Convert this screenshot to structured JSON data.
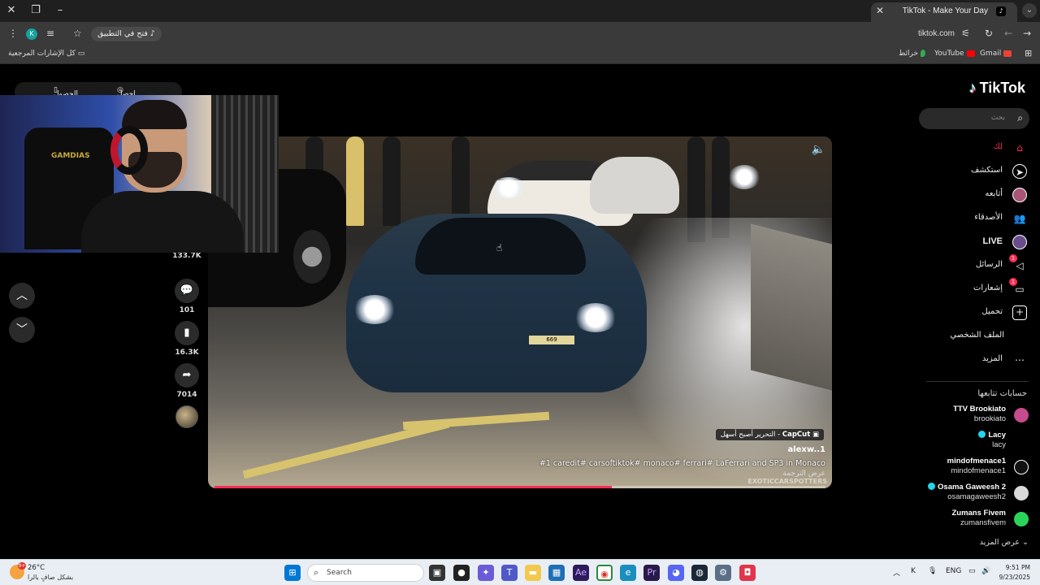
{
  "browser": {
    "tab_title": "TikTok - Make Your Day",
    "url": "tiktok.com",
    "open_in_app": "فتح في التطبيق",
    "profile_initial": "K",
    "bookmarks": {
      "all": "كل الإشارات المرجعية",
      "gmail": "Gmail",
      "youtube": "YouTube",
      "maps": "خرائط"
    }
  },
  "page": {
    "get_coins": "احصل على عملات",
    "get_app": "الحصول على الت..."
  },
  "webcam": {
    "chair_logo": "GAMDIAS"
  },
  "rail": {
    "likes": "133.7K",
    "comments": "101",
    "saves": "16.3K",
    "shares": "7014"
  },
  "video": {
    "capcut_label": "CapCut",
    "capcut_tagline": "التحرير أصبح أسهل",
    "author": "alexw..1",
    "description": "#1 caredit# carsoftiktok# monaco# ferrari# LaFerrari and SP3 in Monaco",
    "see_translation": "عرض الترجمة",
    "watermark": "EXOTICCARSPOTTERS",
    "plate": "669",
    "progress": 0.65
  },
  "sidebar": {
    "logo": "TikTok",
    "search_placeholder": "بحث",
    "nav": [
      {
        "label": "لك"
      },
      {
        "label": "استكشف"
      },
      {
        "label": "أتابعه"
      },
      {
        "label": "الأصدقاء"
      },
      {
        "label": "LIVE"
      },
      {
        "label": "الرسائل",
        "badge": "1"
      },
      {
        "label": "إشعارات",
        "badge": "1"
      },
      {
        "label": "تحميل"
      },
      {
        "label": "الملف الشخصي"
      },
      {
        "label": "المزيد"
      }
    ],
    "following_title": "حسابات تتابعها",
    "accounts": [
      {
        "name": "TTV Brookiato",
        "handle": "brookiato",
        "verified": false,
        "color": "#c64b8c"
      },
      {
        "name": "Lacy",
        "handle": "lacy",
        "verified": true,
        "color": "#000000"
      },
      {
        "name": "mindofmenace1",
        "handle": "mindofmenace1",
        "verified": false,
        "color": "#ffffff"
      },
      {
        "name": "Osama Gaweesh 2",
        "handle": "osamagaweesh2",
        "verified": true,
        "color": "#d9d9d9"
      },
      {
        "name": "Zumans Fivem",
        "handle": "zumansfivem",
        "verified": false,
        "color": "#2bd35a"
      }
    ],
    "see_more": "عرض المزيد"
  },
  "taskbar": {
    "weather_temp": "26°C",
    "weather_desc": "بشكل صافٍ بالرا",
    "weather_badge": "9+",
    "search": "Search",
    "lang": "ENG",
    "time": "9:51 PM",
    "date": "9/23/2025"
  }
}
